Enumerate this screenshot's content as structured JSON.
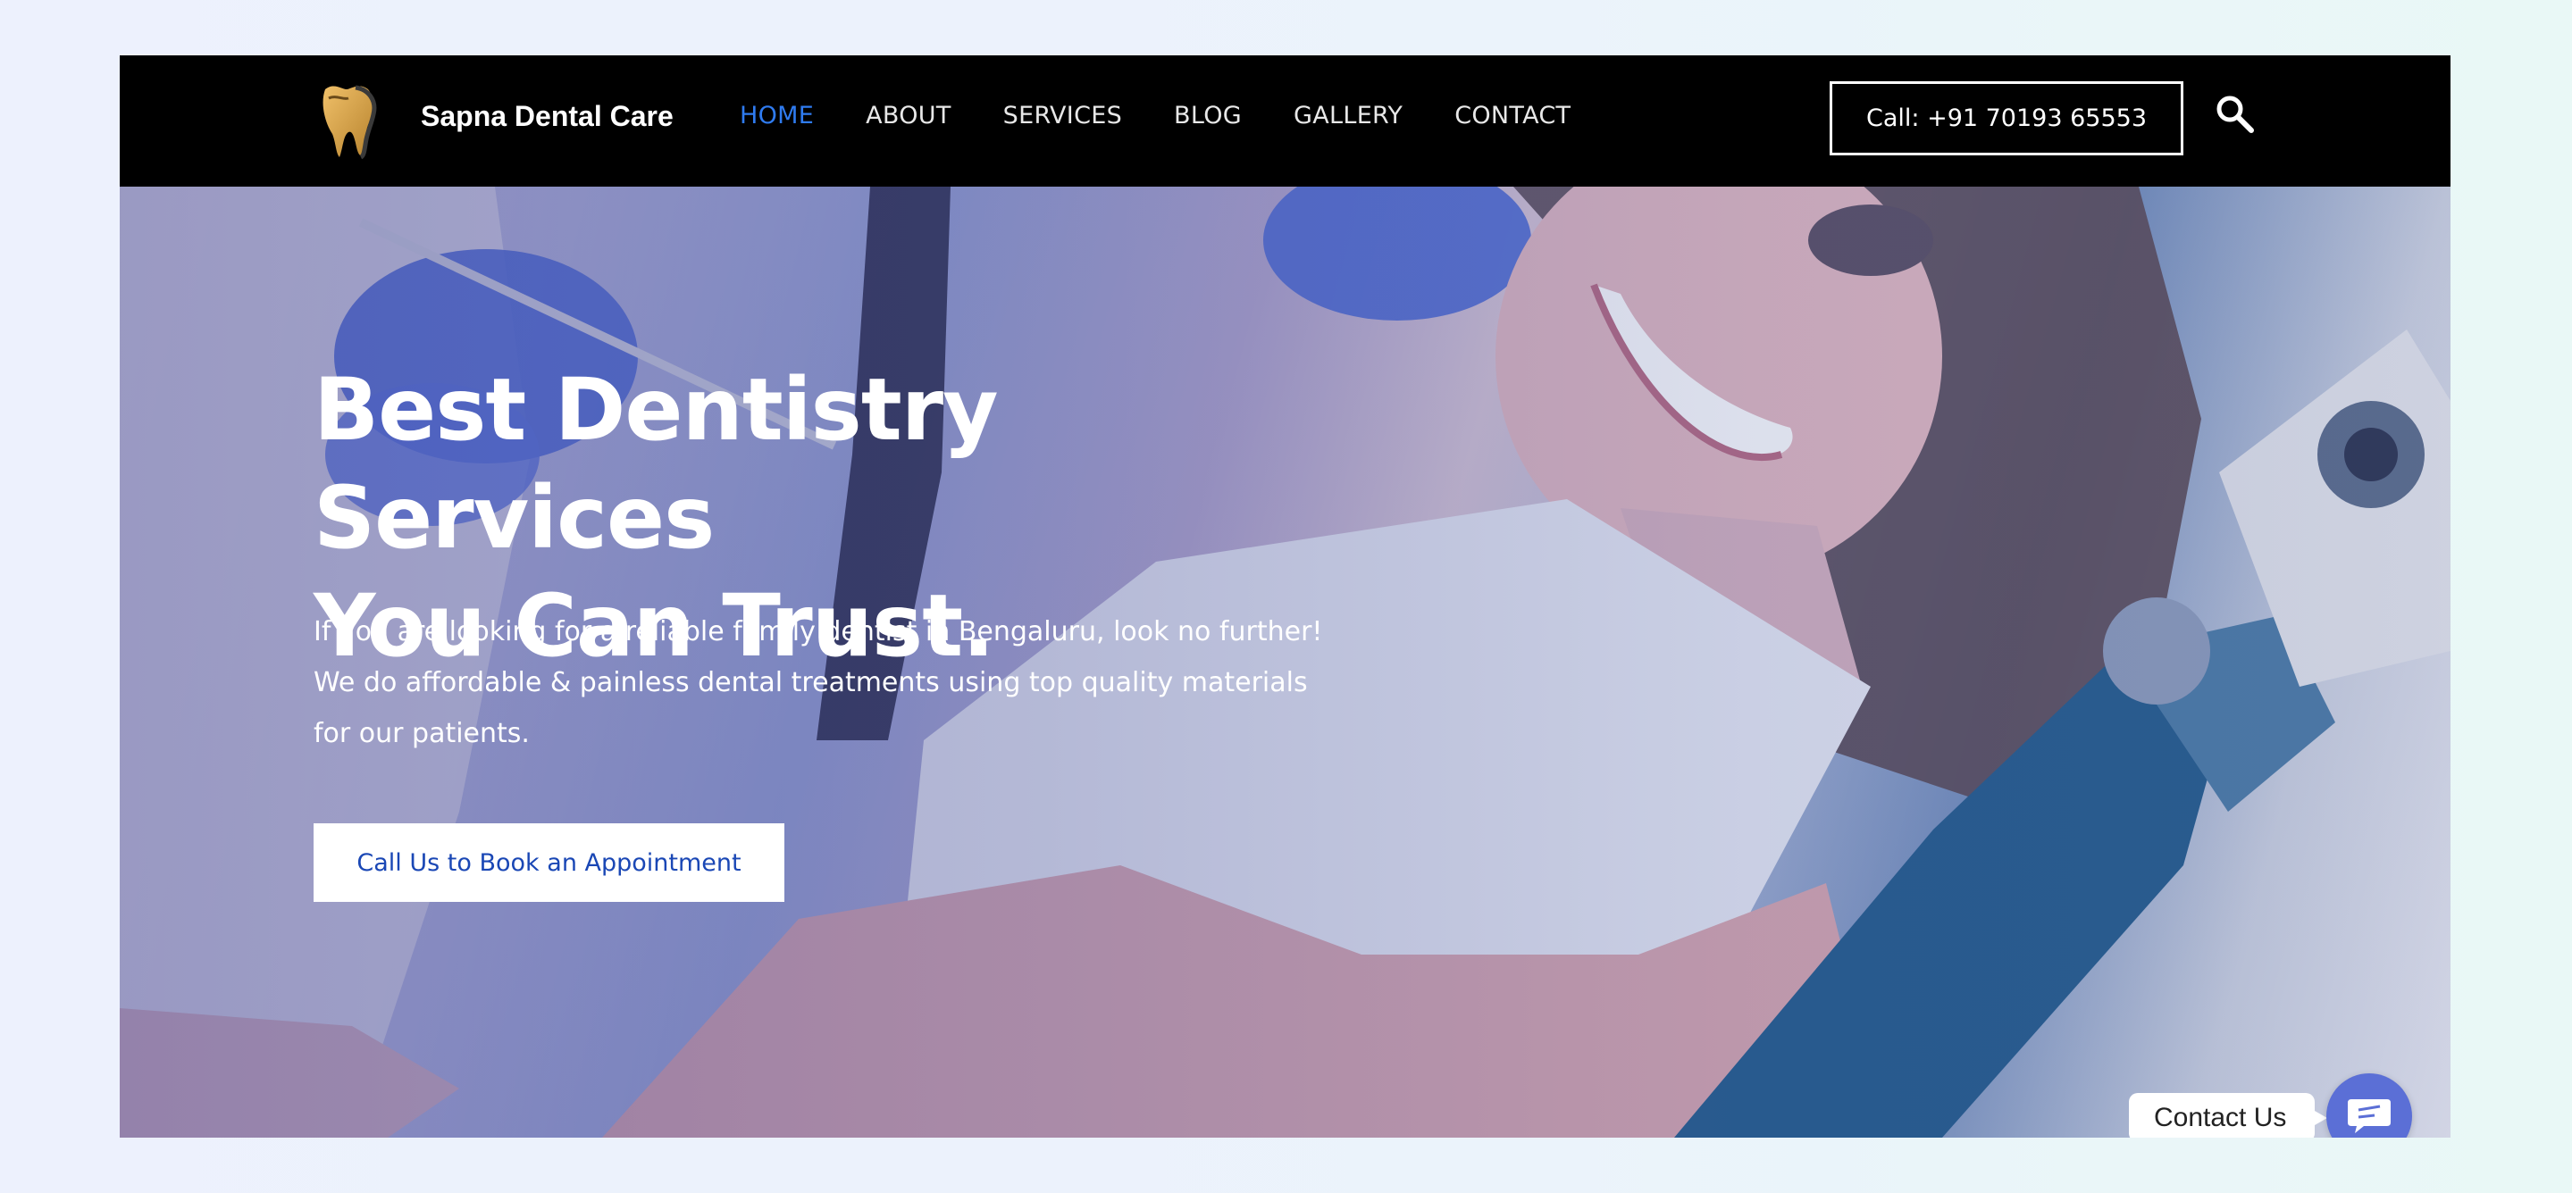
{
  "header": {
    "brand_name": "Sapna Dental Care",
    "logo_icon": "tooth-logo-icon",
    "nav": [
      {
        "label": "HOME",
        "active": true
      },
      {
        "label": "ABOUT",
        "active": false
      },
      {
        "label": "SERVICES",
        "active": false
      },
      {
        "label": "BLOG",
        "active": false
      },
      {
        "label": "GALLERY",
        "active": false
      },
      {
        "label": "CONTACT",
        "active": false
      }
    ],
    "call_button": "Call: +91 70193 65553",
    "search_icon": "search-icon",
    "active_color": "#2f7bf0"
  },
  "hero": {
    "title_line1": "Best Dentistry Services",
    "title_line2": "You Can Trust.",
    "description_line1": "If you are looking for a reliable family dentist in Bengaluru, look no further!",
    "description_line2": "We do affordable & painless dental treatments using top quality materials",
    "description_line3": "for our patients.",
    "cta_button": "Call Us to Book an Appointment",
    "cta_color": "#1a47b5"
  },
  "floating": {
    "contact_label": "Contact Us",
    "chat_icon": "chat-bubble-icon",
    "chat_color": "#5b6fd6"
  }
}
